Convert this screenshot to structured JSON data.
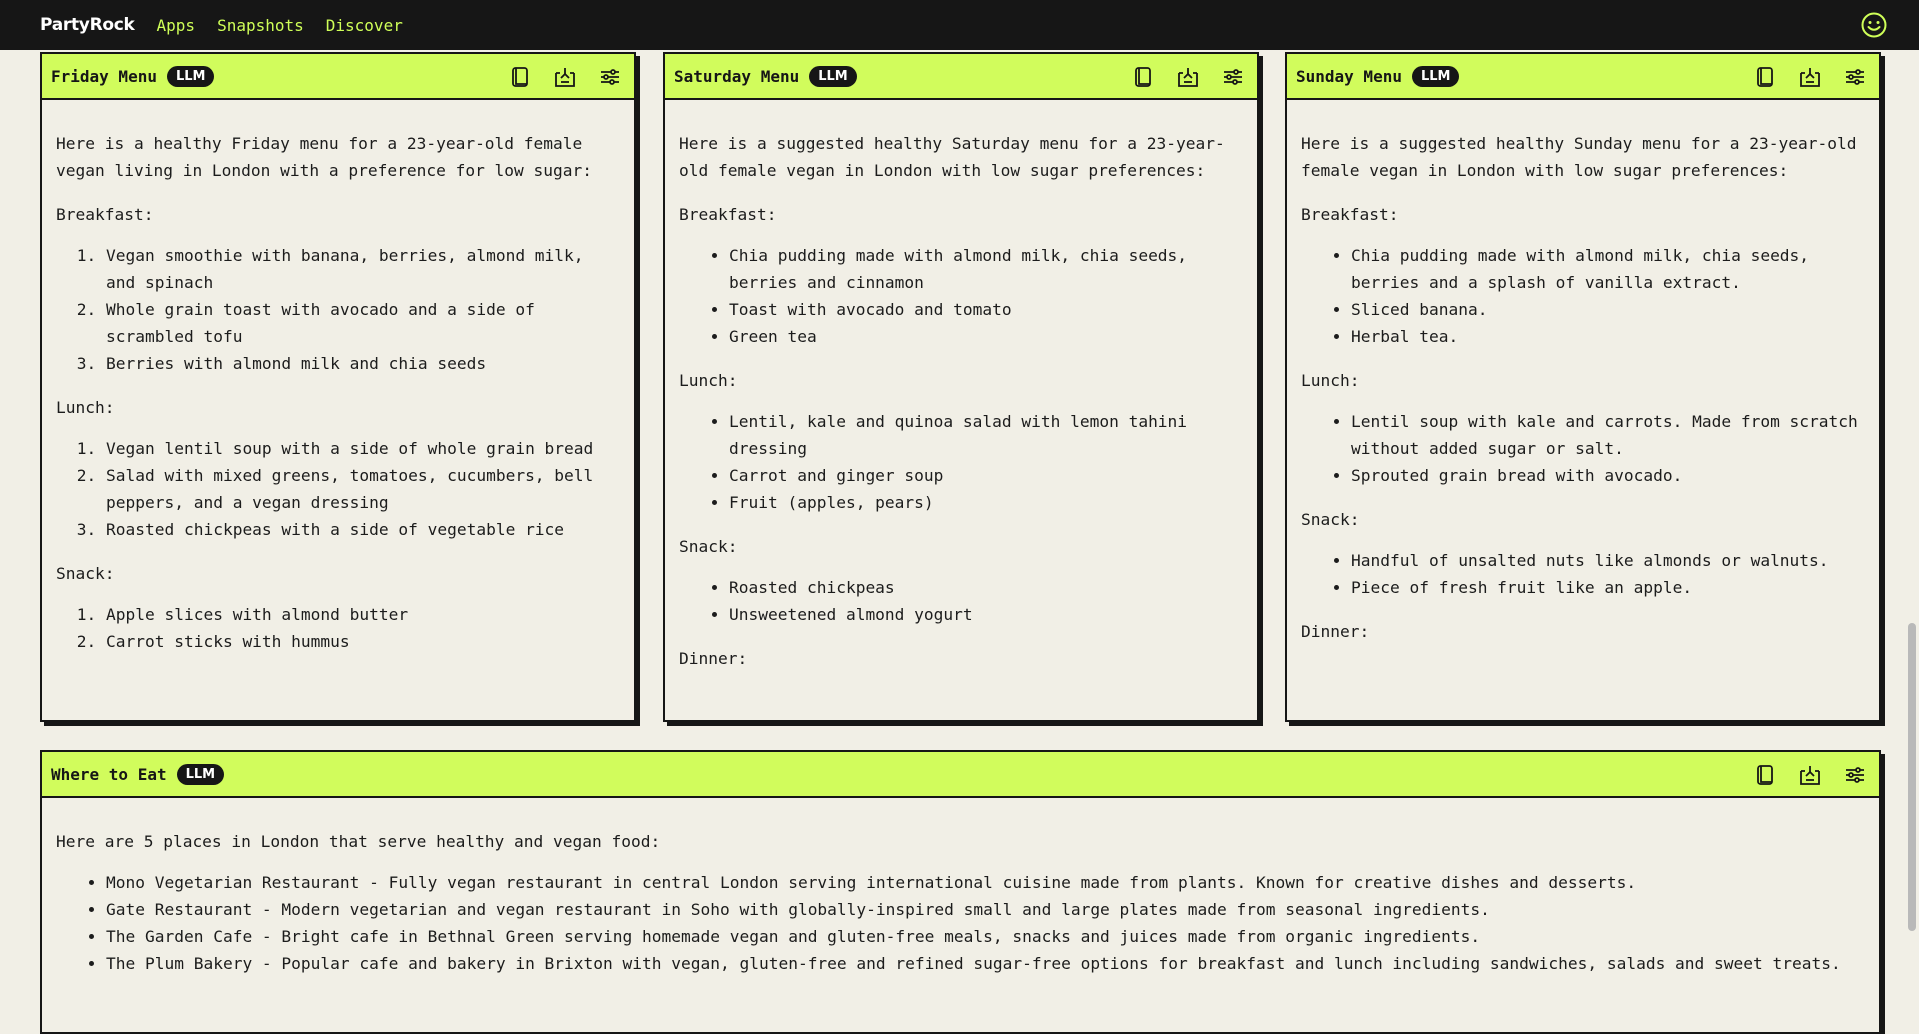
{
  "nav": {
    "brand": "PartyRock",
    "links": [
      "Apps",
      "Snapshots",
      "Discover"
    ]
  },
  "cards": [
    {
      "title": "Friday Menu",
      "badge": "LLM",
      "intro": "Here is a healthy Friday menu for a 23-year-old female vegan living in London with a preference for low sugar:",
      "sections": [
        {
          "heading": "Breakfast:",
          "list": "ol",
          "items": [
            "Vegan smoothie with banana, berries, almond milk, and spinach",
            "Whole grain toast with avocado and a side of scrambled tofu",
            "Berries with almond milk and chia seeds"
          ]
        },
        {
          "heading": "Lunch:",
          "list": "ol",
          "items": [
            "Vegan lentil soup with a side of whole grain bread",
            "Salad with mixed greens, tomatoes, cucumbers, bell peppers, and a vegan dressing",
            "Roasted chickpeas with a side of vegetable rice"
          ]
        },
        {
          "heading": "Snack:",
          "list": "ol",
          "items": [
            "Apple slices with almond butter",
            "Carrot sticks with hummus"
          ]
        }
      ]
    },
    {
      "title": "Saturday Menu",
      "badge": "LLM",
      "intro": "Here is a suggested healthy Saturday menu for a 23-year-old female vegan in London with low sugar preferences:",
      "sections": [
        {
          "heading": "Breakfast:",
          "list": "ul",
          "items": [
            "Chia pudding made with almond milk, chia seeds, berries and cinnamon",
            "Toast with avocado and tomato",
            "Green tea"
          ]
        },
        {
          "heading": "Lunch:",
          "list": "ul",
          "items": [
            "Lentil, kale and quinoa salad with lemon tahini dressing",
            "Carrot and ginger soup",
            "Fruit (apples, pears)"
          ]
        },
        {
          "heading": "Snack:",
          "list": "ul",
          "items": [
            "Roasted chickpeas",
            "Unsweetened almond yogurt"
          ]
        },
        {
          "heading": "Dinner:",
          "list": "ul",
          "items": []
        }
      ]
    },
    {
      "title": "Sunday Menu",
      "badge": "LLM",
      "intro": "Here is a suggested healthy Sunday menu for a 23-year-old female vegan in London with low sugar preferences:",
      "sections": [
        {
          "heading": "Breakfast:",
          "list": "ul",
          "items": [
            "Chia pudding made with almond milk, chia seeds, berries and a splash of vanilla extract.",
            "Sliced banana.",
            "Herbal tea."
          ]
        },
        {
          "heading": "Lunch:",
          "list": "ul",
          "items": [
            "Lentil soup with kale and carrots. Made from scratch without added sugar or salt.",
            "Sprouted grain bread with avocado."
          ]
        },
        {
          "heading": "Snack:",
          "list": "ul",
          "items": [
            "Handful of unsalted nuts like almonds or walnuts.",
            "Piece of fresh fruit like an apple."
          ]
        },
        {
          "heading": "Dinner:",
          "list": "ul",
          "items": []
        }
      ]
    },
    {
      "title": "Where to Eat",
      "badge": "LLM",
      "intro": "Here are 5 places in London that serve healthy and vegan food:",
      "sections": [
        {
          "heading": "",
          "list": "ul",
          "items": [
            "Mono Vegetarian Restaurant - Fully vegan restaurant in central London serving international cuisine made from plants. Known for creative dishes and desserts.",
            "Gate Restaurant - Modern vegetarian and vegan restaurant in Soho with globally-inspired small and large plates made from seasonal ingredients.",
            "The Garden Cafe - Bright cafe in Bethnal Green serving homemade vegan and gluten-free meals, snacks and juices made from organic ingredients.",
            "The Plum Bakery - Popular cafe and bakery in Brixton with vegan, gluten-free and refined sugar-free options for breakfast and lunch including sandwiches, salads and sweet treats."
          ]
        }
      ]
    }
  ],
  "icons": {
    "copy": "copy-icon",
    "share": "share-icon",
    "settings": "sliders-icon",
    "profile": "smiley-face-icon"
  },
  "colors": {
    "accent": "#d1fc5c",
    "nav_link": "#cfff58",
    "dark": "#161616",
    "background": "#f1efe6"
  }
}
